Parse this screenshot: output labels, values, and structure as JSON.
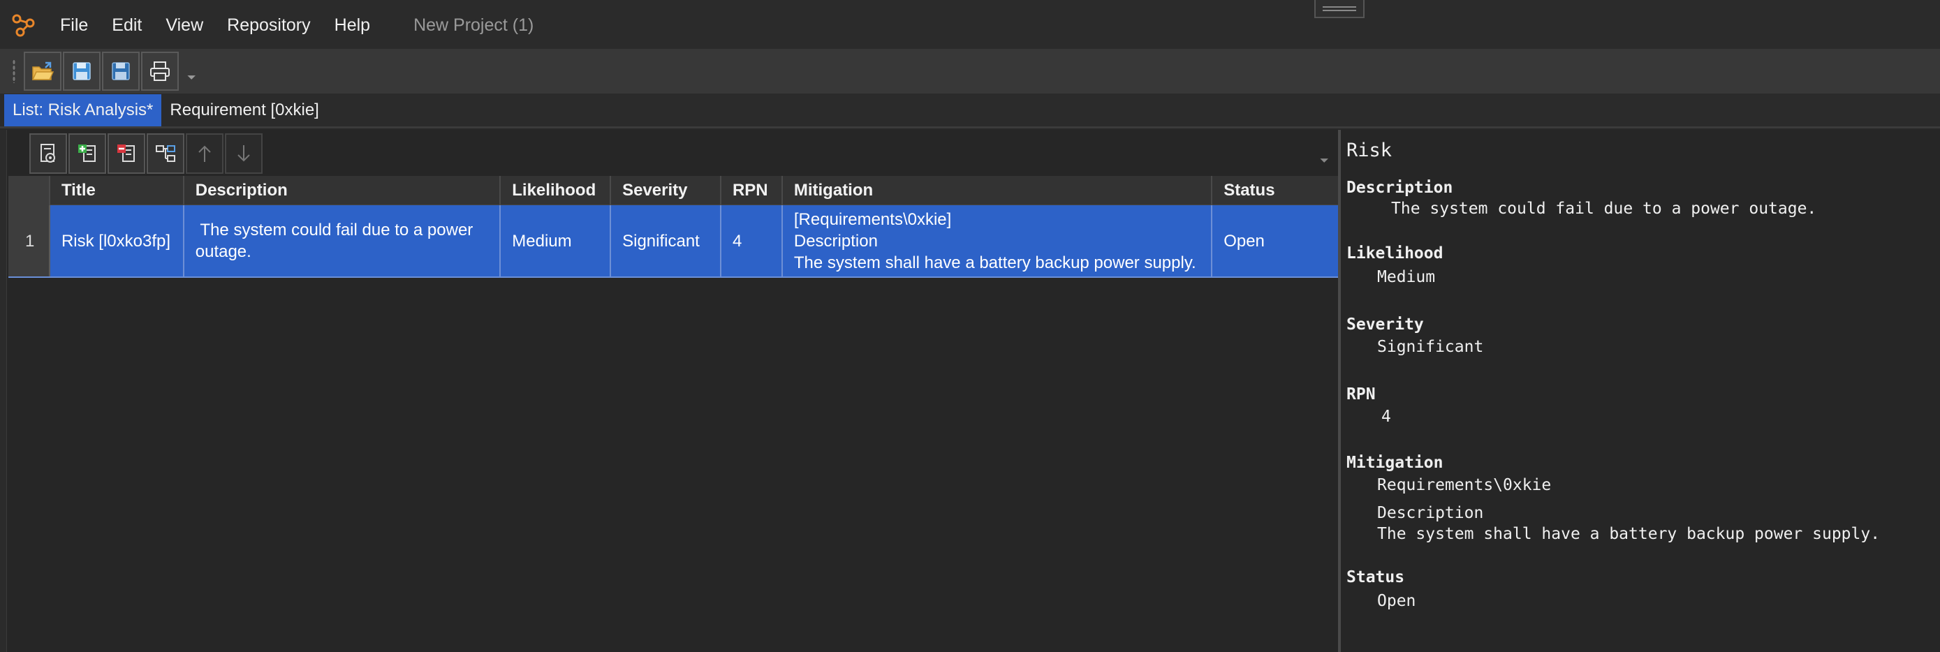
{
  "menubar": {
    "items": [
      "File",
      "Edit",
      "View",
      "Repository",
      "Help"
    ],
    "project_title": "New Project (1)"
  },
  "toolbar": {
    "buttons": [
      "open-folder-icon",
      "save-icon",
      "save-as-icon",
      "print-icon"
    ]
  },
  "tabs": [
    {
      "label": "List: Risk Analysis*",
      "active": true
    },
    {
      "label": "Requirement [0xkie]",
      "active": false
    }
  ],
  "list_toolbar": {
    "buttons": [
      "properties-icon",
      "add-item-icon",
      "remove-item-icon",
      "hierarchy-icon",
      "move-up-icon",
      "move-down-icon"
    ]
  },
  "grid": {
    "columns": [
      "Title",
      "Description",
      "Likelihood",
      "Severity",
      "RPN",
      "Mitigation",
      "Status"
    ],
    "rows": [
      {
        "num": "1",
        "title": "Risk [l0xko3fp]",
        "description": " The system could fail due to a power outage.",
        "likelihood": "Medium",
        "severity": "Significant",
        "rpn": "4",
        "mitigation": [
          "[Requirements\\0xkie]",
          "Description",
          "The system shall have a battery backup power supply."
        ],
        "status": "Open"
      }
    ]
  },
  "detail": {
    "heading": "Risk",
    "description_label": "Description",
    "description_value": "The system could fail due to a power outage.",
    "likelihood_label": "Likelihood",
    "likelihood_value": "Medium",
    "severity_label": "Severity",
    "severity_value": "Significant",
    "rpn_label": "RPN",
    "rpn_value": "4",
    "mitigation_label": "Mitigation",
    "mitigation_ref": "Requirements\\0xkie",
    "mitigation_desc_label": "Description",
    "mitigation_desc_value": "The system shall have a battery backup power supply.",
    "status_label": "Status",
    "status_value": "Open"
  },
  "colors": {
    "accent": "#2d62c8",
    "background": "#262626",
    "panel": "#383838"
  }
}
